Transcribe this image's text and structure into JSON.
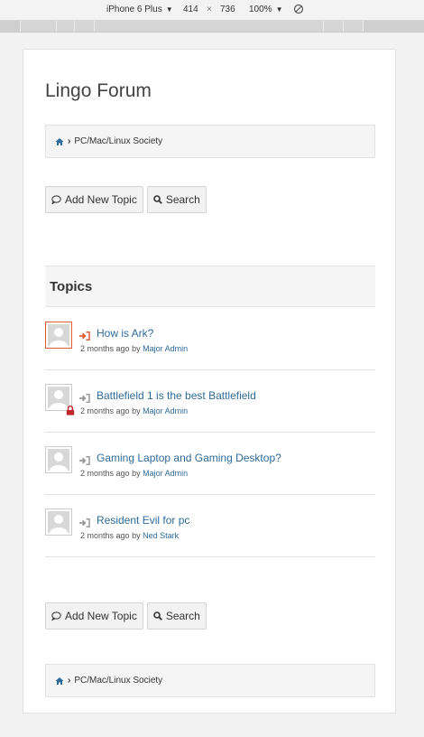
{
  "devtools": {
    "device": "iPhone 6 Plus",
    "width": "414",
    "times": "×",
    "height": "736",
    "zoom": "100%"
  },
  "forum": {
    "title": "Lingo Forum"
  },
  "breadcrumb": {
    "category": "PC/Mac/Linux Society"
  },
  "actions": {
    "add_topic": "Add New Topic",
    "search": "Search"
  },
  "topics": {
    "heading": "Topics",
    "items": [
      {
        "title": "How is Ark?",
        "time": "2 months ago",
        "by": "by",
        "author": "Major Admin",
        "active": true,
        "locked": false
      },
      {
        "title": "Battlefield 1 is the best Battlefield",
        "time": "2 months ago",
        "by": "by",
        "author": "Major Admin",
        "active": false,
        "locked": true
      },
      {
        "title": "Gaming Laptop and Gaming Desktop?",
        "time": "2 months ago",
        "by": "by",
        "author": "Major Admin",
        "active": false,
        "locked": false
      },
      {
        "title": "Resident Evil for pc",
        "time": "2 months ago",
        "by": "by",
        "author": "Ned Stark",
        "active": false,
        "locked": false
      }
    ]
  },
  "colors": {
    "link": "#2f6b9a",
    "active_accent": "#e25a3a",
    "lock": "#c0282d"
  }
}
